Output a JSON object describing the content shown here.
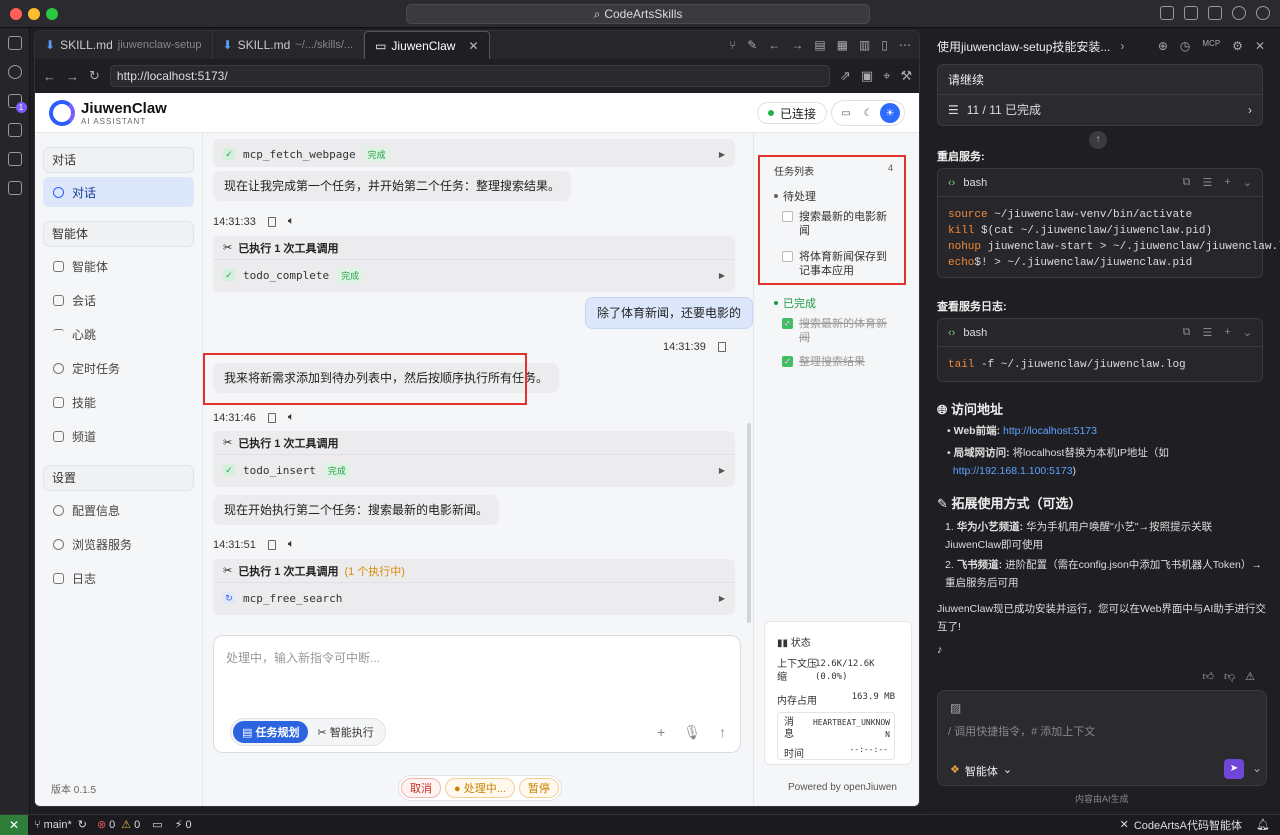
{
  "titlebar": {
    "search": "CodeArtsSkills"
  },
  "editor_tabs": [
    {
      "name": "SKILL.md",
      "path": "jiuwenclaw-setup"
    },
    {
      "name": "SKILL.md",
      "path": "~/.../skills/..."
    },
    {
      "name": "JiuwenClaw",
      "path": ""
    }
  ],
  "browser": {
    "url": "http://localhost:5173/"
  },
  "app": {
    "name": "JiuwenClaw",
    "subtitle": "AI ASSISTANT",
    "connection": "已连接"
  },
  "nav": {
    "group_chat": "对话",
    "item_chat": "对话",
    "group_agent": "智能体",
    "agent_items": [
      "智能体",
      "会话",
      "心跳",
      "定时任务",
      "技能",
      "频道"
    ],
    "group_settings": "设置",
    "settings_items": [
      "配置信息",
      "浏览器服务",
      "日志"
    ],
    "version": "版本 0.1.5"
  },
  "chat": {
    "tool1": {
      "name": "mcp_fetch_webpage",
      "status": "完成"
    },
    "msg1": "现在让我完成第一个任务，并开始第二个任务：整理搜索结果。",
    "ts1": "14:31:33",
    "tool2": {
      "header": "已执行 1 次工具调用",
      "name": "todo_complete",
      "status": "完成"
    },
    "user_msg": "除了体育新闻，还要电影的",
    "ts_user": "14:31:39",
    "msg2": "我来将新需求添加到待办列表中，然后按顺序执行所有任务。",
    "ts2": "14:31:46",
    "tool3": {
      "header": "已执行 1 次工具调用",
      "name": "todo_insert",
      "status": "完成"
    },
    "msg3": "现在开始执行第二个任务：搜索最新的电影新闻。",
    "ts3": "14:31:51",
    "tool4": {
      "header": "已执行 1 次工具调用",
      "running": "(1 个执行中)",
      "name": "mcp_free_search"
    },
    "input_placeholder": "处理中，输入新指令可中断...",
    "mode_plan": "任务规划",
    "mode_exec": "智能执行",
    "ctrl_cancel": "取消",
    "ctrl_processing": "处理中...",
    "ctrl_pause": "暂停"
  },
  "tasks": {
    "title": "任务列表",
    "count": "4",
    "pending_label": "待处理",
    "pending": [
      "搜索最新的电影新闻",
      "将体育新闻保存到记事本应用"
    ],
    "done_label": "已完成",
    "done": [
      "搜索最新的体育新闻",
      "整理搜索结果"
    ],
    "status_title": "状态",
    "ctx_label": "上下文压缩",
    "ctx_value": "12.6K/12.6K (0.0%)",
    "mem_label": "内存占用",
    "mem_value": "163.9 MB",
    "msg_label": "消息",
    "msg_value": "HEARTBEAT_UNKNOWN",
    "time_label": "时间",
    "time_value": "--:--:--",
    "powered": "Powered by openJiuwen"
  },
  "side": {
    "title": "使用jiuwenclaw-setup技能安装...",
    "continue": "请继续",
    "progress": "11 / 11 已完成",
    "restart_title": "重启服务:",
    "lang": "bash",
    "restart_code": [
      "source ~/jiuwenclaw-venv/bin/activate",
      "kill $(cat ~/.jiuwenclaw/jiuwenclaw.pid)",
      "nohup jiuwenclaw-start > ~/.jiuwenclaw/jiuwenclaw.log 2>&1 &",
      "echo$! > ~/.jiuwenclaw/jiuwenclaw.pid"
    ],
    "log_title": "查看服务日志:",
    "log_code": "tail -f ~/.jiuwenclaw/jiuwenclaw.log",
    "access_title": "访问地址",
    "web_label": "Web前端:",
    "web_url": "http://localhost:5173",
    "lan_label": "局域网访问:",
    "lan_text": "将localhost替换为本机IP地址（如",
    "lan_url": "http://192.168.1.100:5173",
    "lan_end": ")",
    "extend_title": "拓展使用方式（可选）",
    "ext1_label": "华为小艺频道:",
    "ext1_text": "华为手机用户唤醒\"小艺\"→按照提示关联JiuwenClaw即可使用",
    "ext2_label": "飞书频道:",
    "ext2_text": "进阶配置（需在config.json中添加飞书机器人Token）→重启服务后可用",
    "final_msg": "JiuwenClaw现已成功安装并运行，您可以在Web界面中与AI助手进行交互了!",
    "input_placeholder": "/ 调用快捷指令，# 添加上下文",
    "agent": "智能体",
    "footer": "内容由AI生成"
  },
  "statusbar": {
    "branch": "main*",
    "errors": "0",
    "warnings": "0",
    "ports": "0",
    "right": "CodeArtsA代码智能体"
  }
}
